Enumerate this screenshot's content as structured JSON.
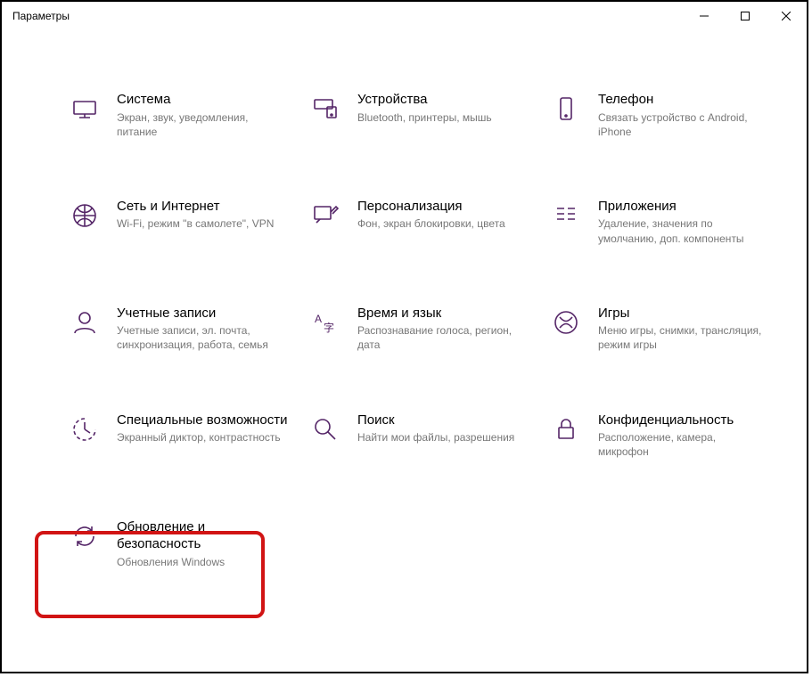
{
  "window": {
    "title": "Параметры"
  },
  "colors": {
    "accent": "#542567",
    "highlight": "#d11414"
  },
  "tiles": [
    {
      "title": "Система",
      "desc": "Экран, звук, уведомления, питание"
    },
    {
      "title": "Устройства",
      "desc": "Bluetooth, принтеры, мышь"
    },
    {
      "title": "Телефон",
      "desc": "Связать устройство с Android, iPhone"
    },
    {
      "title": "Сеть и Интернет",
      "desc": "Wi-Fi, режим \"в самолете\", VPN"
    },
    {
      "title": "Персонализация",
      "desc": "Фон, экран блокировки, цвета"
    },
    {
      "title": "Приложения",
      "desc": "Удаление, значения по умолчанию, доп. компоненты"
    },
    {
      "title": "Учетные записи",
      "desc": "Учетные записи, эл. почта, синхронизация, работа, семья"
    },
    {
      "title": "Время и язык",
      "desc": "Распознавание голоса, регион, дата"
    },
    {
      "title": "Игры",
      "desc": "Меню игры, снимки, трансляция, режим игры"
    },
    {
      "title": "Специальные возможности",
      "desc": "Экранный диктор, контрастность"
    },
    {
      "title": "Поиск",
      "desc": "Найти мои файлы, разрешения"
    },
    {
      "title": "Конфиденциальность",
      "desc": "Расположение, камера, микрофон"
    },
    {
      "title": "Обновление и безопасность",
      "desc": "Обновления Windows"
    }
  ]
}
